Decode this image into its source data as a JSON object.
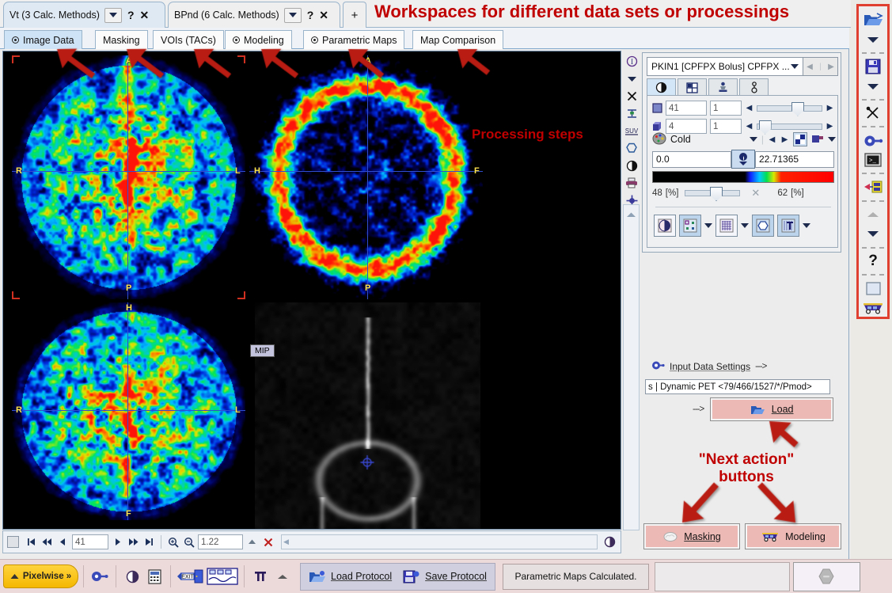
{
  "app": {
    "status_message": "Parametric Maps Calculated."
  },
  "annotations": {
    "workspaces": "Workspaces for different data sets or processings",
    "processing_steps": "Processing steps",
    "next_action": "\"Next action\"\nbuttons",
    "next_action_line1": "\"Next action\"",
    "next_action_line2": "buttons",
    "color": "#c00000"
  },
  "workspace_tabs": [
    {
      "label": "Vt (3 Calc. Methods)",
      "dropdown": "chevron-down-icon",
      "help": "?",
      "close": "✕",
      "active": true
    },
    {
      "label": "BPnd (6 Calc. Methods)",
      "dropdown": "chevron-down-icon",
      "help": "?",
      "close": "✕",
      "active": false
    }
  ],
  "workspace_add": "+",
  "step_tabs": [
    {
      "label": "Image Data",
      "has_radio": true,
      "active": true
    },
    {
      "label": "Masking",
      "has_radio": false,
      "active": false
    },
    {
      "label": "VOIs (TACs)",
      "has_radio": false,
      "active": false
    },
    {
      "label": "Modeling",
      "has_radio": true,
      "active": false
    },
    {
      "label": "Parametric Maps",
      "has_radio": true,
      "active": false
    },
    {
      "label": "Map Comparison",
      "has_radio": false,
      "active": false
    }
  ],
  "viewport": {
    "panes": [
      {
        "name": "transverse",
        "labels": {
          "top": "A",
          "bottom": "P",
          "left": "R",
          "right": "L"
        }
      },
      {
        "name": "coronal",
        "labels": {
          "top": "A",
          "bottom": "P",
          "left": "H",
          "right": "F"
        }
      },
      {
        "name": "sagittal",
        "labels": {
          "top": "H",
          "bottom": "F",
          "left": "R",
          "right": "L"
        }
      },
      {
        "name": "mip",
        "labels": {
          "top": "",
          "bottom": "",
          "left": "",
          "right": ""
        }
      }
    ],
    "mip_badge": "MIP"
  },
  "viewnav": {
    "frame_value": "41",
    "zoom_value": "1.22",
    "first_icon": "skip-first-icon",
    "prev_fast_icon": "rewind-icon",
    "prev_icon": "prev-icon",
    "next_icon": "next-icon",
    "next_fast_icon": "forward-icon",
    "last_icon": "skip-last-icon",
    "zoom_in_icon": "zoom-in-icon",
    "zoom_out_icon": "zoom-out-icon",
    "collapse_icon": "triangle-up-icon",
    "clear_icon": "red-x-icon",
    "layout_icon": "layout-box-icon"
  },
  "mini_icons": [
    "info-icon",
    "chevron-down-icon",
    "close-icon",
    "measure-icon",
    "suv-icon",
    "polygon-icon",
    "contrast-icon",
    "printer-icon",
    "crosshair-icon"
  ],
  "control_panel": {
    "series": "PKIN1 [CPFPX Bolus] CPFPX ...",
    "series_dropdown_icon": "chevron-down-icon",
    "series_prev_icon": "prev-icon",
    "series_next_icon": "next-icon",
    "tabs": [
      {
        "icon": "contrast-icon",
        "active": true
      },
      {
        "icon": "layout-grid-icon",
        "active": false
      },
      {
        "icon": "stamp-icon",
        "active": false
      },
      {
        "icon": "thermometer-icon",
        "active": false
      }
    ],
    "slice_slider": {
      "icon": "slice-plane-icon",
      "value": "41",
      "increment": "1"
    },
    "frame_slider": {
      "icon": "cube-icon",
      "value": "4",
      "increment": "1"
    },
    "colormap": {
      "palette_icon": "palette-icon",
      "name": "Cold",
      "dropdown_icon": "chevron-down-icon",
      "prev_icon": "prev-icon",
      "next_icon": "next-icon",
      "invert_icon": "invert-icon",
      "copy_icon": "copy-icon",
      "more_icon": "chevron-down-icon"
    },
    "value_min": "0.0",
    "value_max": "22.71365",
    "threshold_icon": "threshold-icon",
    "percent_low": "48",
    "percent_low_unit": "[%]",
    "percent_high": "62",
    "percent_high_unit": "[%]",
    "percent_clear_icon": "close-icon",
    "tool_buttons": [
      {
        "icon": "fusion-icon",
        "active": false
      },
      {
        "icon": "scatter-icon",
        "active": true
      },
      {
        "icon": "chevron-down-icon",
        "active": false
      },
      {
        "icon": "grid-overlay-icon",
        "active": false
      },
      {
        "icon": "chevron-down-icon",
        "active": false
      },
      {
        "icon": "circle-voi-icon",
        "active": true
      },
      {
        "icon": "annotate-icon",
        "active": true
      },
      {
        "icon": "chevron-down-icon",
        "active": false
      }
    ]
  },
  "input_data": {
    "gear_icon": "settings-gear-icon",
    "label": "Input Data Settings",
    "arrow": "--->",
    "path": "s | Dynamic PET <79/466/1527/*/Pmod>",
    "load_arrow": "--->",
    "load_label": "Load",
    "load_icon": "open-folder-icon"
  },
  "action_buttons": [
    {
      "label": "Masking",
      "icon": "brain-mask-icon"
    },
    {
      "label": "Modeling",
      "icon": "car-model-icon"
    }
  ],
  "right_toolbar": [
    {
      "icon": "open-folder-icon",
      "type": "icon"
    },
    {
      "icon": "chevron-down-icon",
      "type": "chevron"
    },
    {
      "type": "separator"
    },
    {
      "icon": "save-disk-icon",
      "type": "icon"
    },
    {
      "icon": "chevron-down-icon",
      "type": "chevron"
    },
    {
      "type": "separator"
    },
    {
      "icon": "scissors-icon",
      "type": "icon"
    },
    {
      "type": "separator"
    },
    {
      "icon": "settings-gear-icon",
      "type": "icon"
    },
    {
      "icon": "terminal-icon",
      "type": "icon"
    },
    {
      "type": "separator"
    },
    {
      "icon": "export-icon",
      "type": "icon"
    },
    {
      "type": "separator"
    },
    {
      "icon": "triangle-up-icon",
      "type": "icon"
    },
    {
      "icon": "chevron-down-icon",
      "type": "chevron"
    },
    {
      "type": "separator"
    },
    {
      "icon": "help-icon",
      "type": "icon"
    },
    {
      "type": "separator"
    },
    {
      "icon": "blank-box-icon",
      "type": "icon"
    },
    {
      "icon": "car-model-icon",
      "type": "icon"
    }
  ],
  "bottom_bar": {
    "pixelwise_label": "Pixelwise »",
    "pixelwise_icon": "triangle-up-icon",
    "icons": [
      "settings-gear-icon",
      "contrast-icon",
      "calculator-icon",
      "exit-icon",
      "waves-icon",
      "pi-icon",
      "triangle-up-icon"
    ],
    "load_protocol": "Load Protocol",
    "load_protocol_icon": "open-folder-icon",
    "save_protocol": "Save Protocol",
    "save_protocol_icon": "save-disk-icon",
    "corner_icon": "round-button-icon"
  },
  "colors": {
    "accent_red": "#c00000",
    "tab_active": "#cfe3f6",
    "action_button": "#edb9b5",
    "pixelwise": "#ffd33d",
    "toolbar_highlight": "#e04030"
  }
}
